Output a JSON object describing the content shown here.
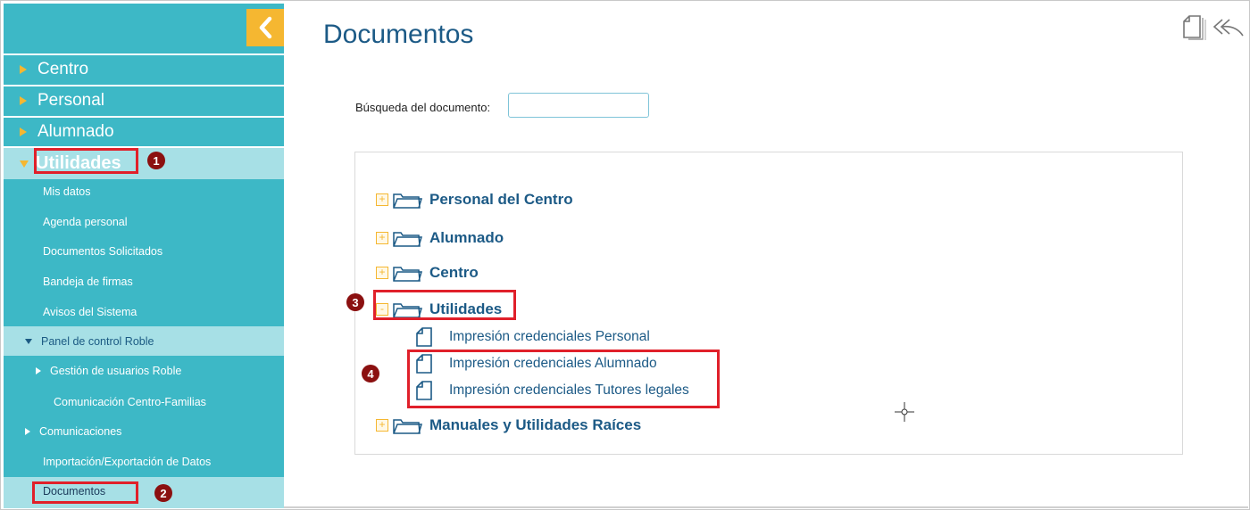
{
  "header": {
    "title": "Documentos"
  },
  "sidebar": {
    "collapse_icon": "chevron-left-icon",
    "main_items": [
      {
        "label": "Centro"
      },
      {
        "label": "Personal"
      },
      {
        "label": "Alumnado"
      },
      {
        "label": "Utilidades"
      }
    ],
    "sub_items": [
      {
        "label": "Mis datos"
      },
      {
        "label": "Agenda personal"
      },
      {
        "label": "Documentos Solicitados"
      },
      {
        "label": "Bandeja de firmas"
      },
      {
        "label": "Avisos del Sistema"
      }
    ],
    "panel": {
      "label": "Panel de control Roble"
    },
    "panel_children": [
      {
        "label": "Gestión de usuarios Roble"
      },
      {
        "label": "Comunicación Centro-Familias"
      }
    ],
    "comunicaciones": {
      "label": "Comunicaciones"
    },
    "import_export": {
      "label": "Importación/Exportación de Datos"
    },
    "documentos": {
      "label": "Documentos"
    }
  },
  "search": {
    "label": "Búsqueda del documento:",
    "value": ""
  },
  "tree": {
    "folders": [
      {
        "label": "Personal del Centro",
        "expanded": false
      },
      {
        "label": "Alumnado",
        "expanded": false
      },
      {
        "label": "Centro",
        "expanded": false
      },
      {
        "label": "Utilidades",
        "expanded": true
      },
      {
        "label": "Manuales y Utilidades Raíces",
        "expanded": false
      }
    ],
    "utilidades_docs": [
      {
        "label": "Impresión credenciales Personal"
      },
      {
        "label": "Impresión credenciales Alumnado"
      },
      {
        "label": "Impresión credenciales Tutores legales"
      }
    ]
  },
  "annotations": [
    "1",
    "2",
    "3",
    "4"
  ],
  "colors": {
    "sidebar": "#3db8c6",
    "sidebar_active": "#a7e0e6",
    "accent": "#f5b731",
    "title": "#1c5a86",
    "annotation": "#e0202a"
  }
}
